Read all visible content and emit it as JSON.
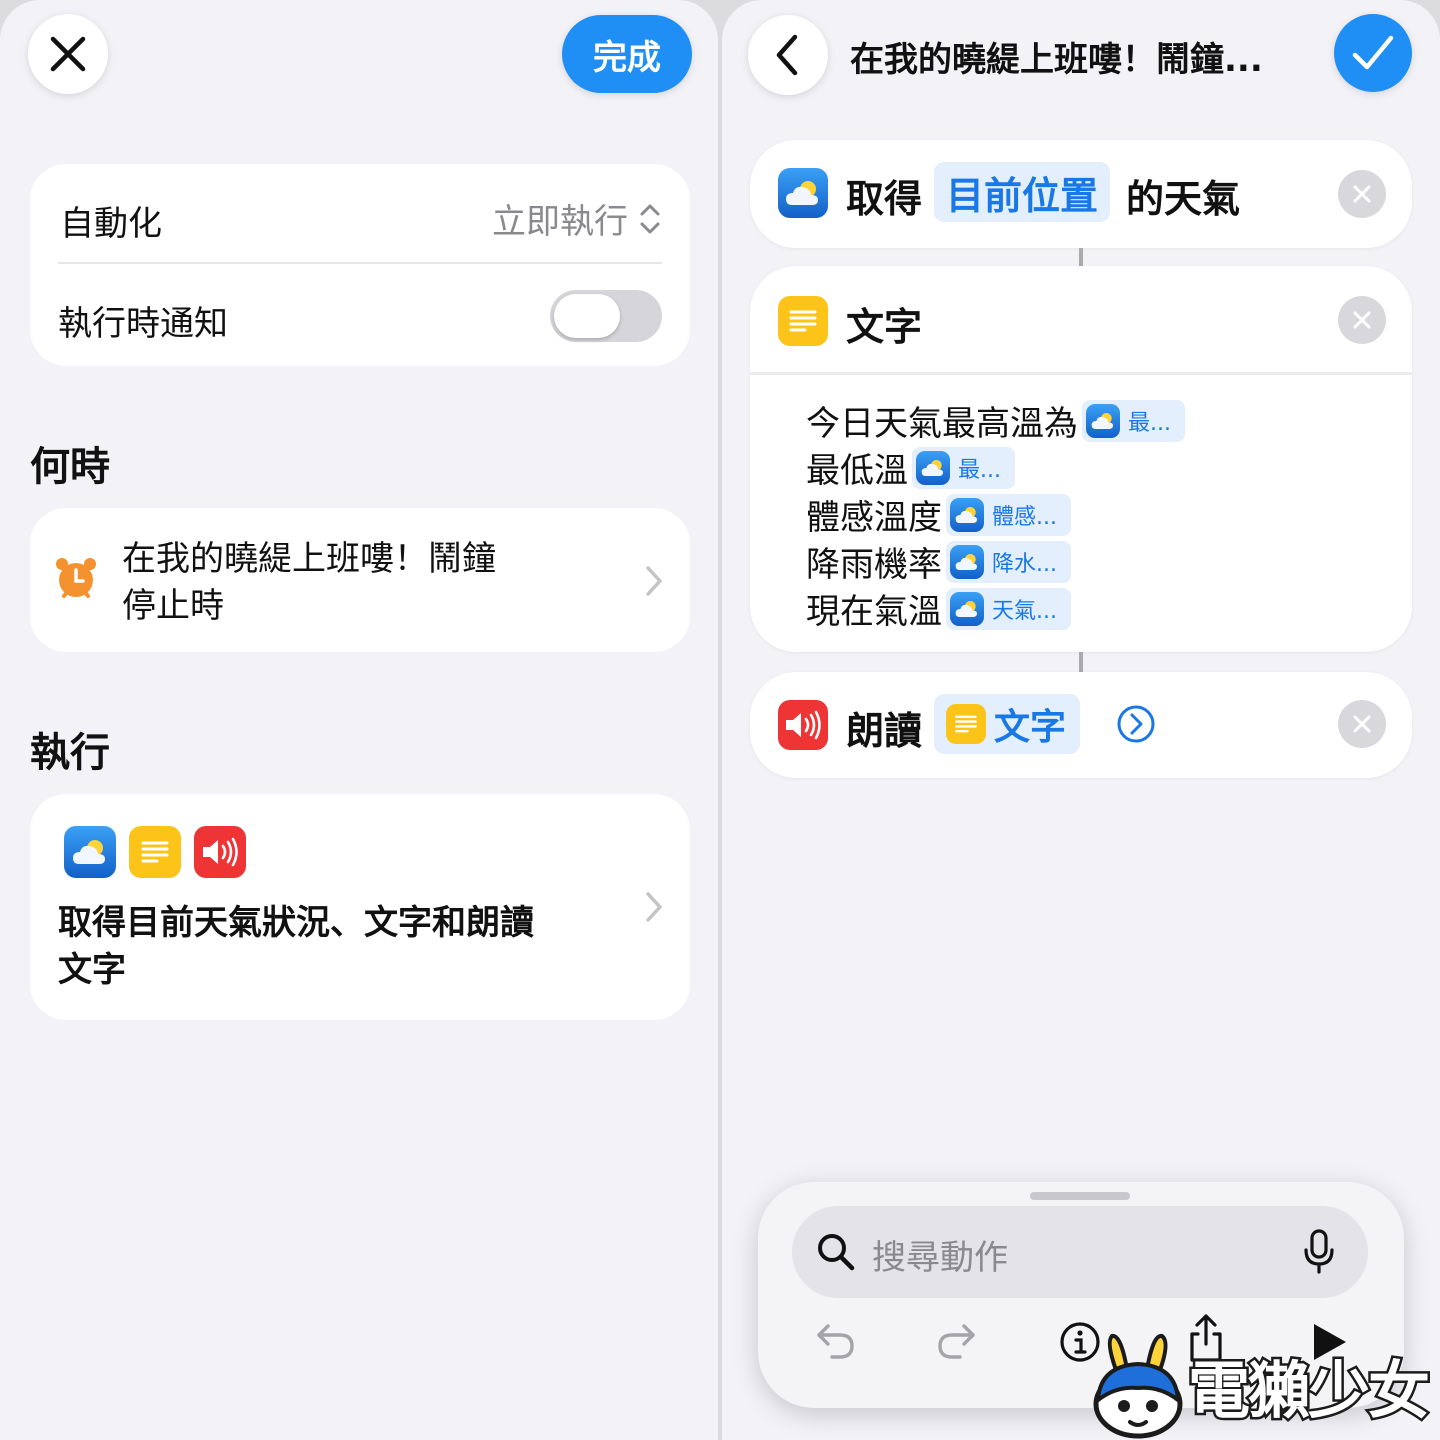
{
  "left": {
    "done_label": "完成",
    "automation": {
      "label": "自動化",
      "value": "立即執行"
    },
    "notify": {
      "label": "執行時通知",
      "on": false
    },
    "when": {
      "title": "何時",
      "line1": "在我的曉緹上班嘍！鬧鐘",
      "line2": "停止時",
      "icon": "alarm-clock-icon"
    },
    "run": {
      "title": "執行",
      "icons": [
        "weather-icon",
        "text-icon",
        "speak-icon"
      ],
      "line1": "取得目前天氣狀況、文字和朗讀",
      "line2": "文字"
    }
  },
  "right": {
    "title": "在我的曉緹上班嘍！鬧鐘...",
    "actions": {
      "weather": {
        "verb": "取得",
        "param": "目前位置",
        "suffix": "的天氣",
        "icon": "weather-icon"
      },
      "text": {
        "title": "文字",
        "icon": "text-icon",
        "lines": [
          {
            "label": "今日天氣最高溫為",
            "token": "最..."
          },
          {
            "label": "最低溫",
            "token": "最..."
          },
          {
            "label": "體感溫度",
            "token": "體感..."
          },
          {
            "label": "降雨機率",
            "token": "降水..."
          },
          {
            "label": "現在氣溫",
            "token": "天氣..."
          }
        ]
      },
      "speak": {
        "verb": "朗讀",
        "param": "文字",
        "icon": "speak-icon"
      }
    },
    "search": {
      "placeholder": "搜尋動作"
    },
    "toolbar": [
      "undo-icon",
      "redo-icon",
      "info-icon",
      "share-icon",
      "play-icon"
    ]
  },
  "watermark": {
    "text": "電獺少女"
  },
  "colors": {
    "accent": "#1f8ff5",
    "link": "#1a78e6",
    "background": "#f2f2f7",
    "alarm": "#f59230"
  }
}
